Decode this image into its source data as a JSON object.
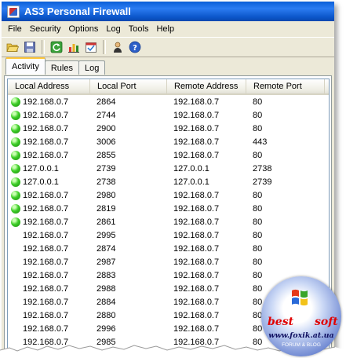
{
  "window": {
    "title": "AS3 Personal Firewall"
  },
  "menu": [
    "File",
    "Security",
    "Options",
    "Log",
    "Tools",
    "Help"
  ],
  "toolbar": [
    {
      "icon": "open-folder-icon"
    },
    {
      "icon": "save-icon"
    },
    {
      "icon": "refresh-icon"
    },
    {
      "icon": "statistics-icon"
    },
    {
      "icon": "schedule-icon"
    },
    {
      "icon": "user-icon"
    },
    {
      "icon": "help-icon"
    }
  ],
  "tabs": [
    "Activity",
    "Rules",
    "Log"
  ],
  "table": {
    "columns": [
      "Local Address",
      "Local Port",
      "Remote Address",
      "Remote Port"
    ],
    "rows": [
      {
        "active": true,
        "local_address": "192.168.0.7",
        "local_port": "2864",
        "remote_address": "192.168.0.7",
        "remote_port": "80"
      },
      {
        "active": true,
        "local_address": "192.168.0.7",
        "local_port": "2744",
        "remote_address": "192.168.0.7",
        "remote_port": "80"
      },
      {
        "active": true,
        "local_address": "192.168.0.7",
        "local_port": "2900",
        "remote_address": "192.168.0.7",
        "remote_port": "80"
      },
      {
        "active": true,
        "local_address": "192.168.0.7",
        "local_port": "3006",
        "remote_address": "192.168.0.7",
        "remote_port": "443"
      },
      {
        "active": true,
        "local_address": "192.168.0.7",
        "local_port": "2855",
        "remote_address": "192.168.0.7",
        "remote_port": "80"
      },
      {
        "active": true,
        "local_address": "127.0.0.1",
        "local_port": "2739",
        "remote_address": "127.0.0.1",
        "remote_port": "2738"
      },
      {
        "active": true,
        "local_address": "127.0.0.1",
        "local_port": "2738",
        "remote_address": "127.0.0.1",
        "remote_port": "2739"
      },
      {
        "active": true,
        "local_address": "192.168.0.7",
        "local_port": "2980",
        "remote_address": "192.168.0.7",
        "remote_port": "80"
      },
      {
        "active": true,
        "local_address": "192.168.0.7",
        "local_port": "2819",
        "remote_address": "192.168.0.7",
        "remote_port": "80"
      },
      {
        "active": true,
        "local_address": "192.168.0.7",
        "local_port": "2861",
        "remote_address": "192.168.0.7",
        "remote_port": "80"
      },
      {
        "active": false,
        "local_address": "192.168.0.7",
        "local_port": "2995",
        "remote_address": "192.168.0.7",
        "remote_port": "80"
      },
      {
        "active": false,
        "local_address": "192.168.0.7",
        "local_port": "2874",
        "remote_address": "192.168.0.7",
        "remote_port": "80"
      },
      {
        "active": false,
        "local_address": "192.168.0.7",
        "local_port": "2987",
        "remote_address": "192.168.0.7",
        "remote_port": "80"
      },
      {
        "active": false,
        "local_address": "192.168.0.7",
        "local_port": "2883",
        "remote_address": "192.168.0.7",
        "remote_port": "80"
      },
      {
        "active": false,
        "local_address": "192.168.0.7",
        "local_port": "2988",
        "remote_address": "192.168.0.7",
        "remote_port": "80"
      },
      {
        "active": false,
        "local_address": "192.168.0.7",
        "local_port": "2884",
        "remote_address": "192.168.0.7",
        "remote_port": "80"
      },
      {
        "active": false,
        "local_address": "192.168.0.7",
        "local_port": "2880",
        "remote_address": "192.168.0.7",
        "remote_port": "80"
      },
      {
        "active": false,
        "local_address": "192.168.0.7",
        "local_port": "2996",
        "remote_address": "192.168.0.7",
        "remote_port": "80"
      },
      {
        "active": false,
        "local_address": "192.168.0.7",
        "local_port": "2985",
        "remote_address": "192.168.0.7",
        "remote_port": "80"
      }
    ]
  },
  "watermark": {
    "left": "best",
    "right": "soft",
    "url": "www.foxik.at.ua",
    "subtitle": "FORUM & BLOG"
  },
  "colors": {
    "titlebar": "#0a5fd8",
    "active_dot": "#3fce29",
    "tab_highlight": "#ffc83c",
    "watermark_text": "#e00000"
  }
}
